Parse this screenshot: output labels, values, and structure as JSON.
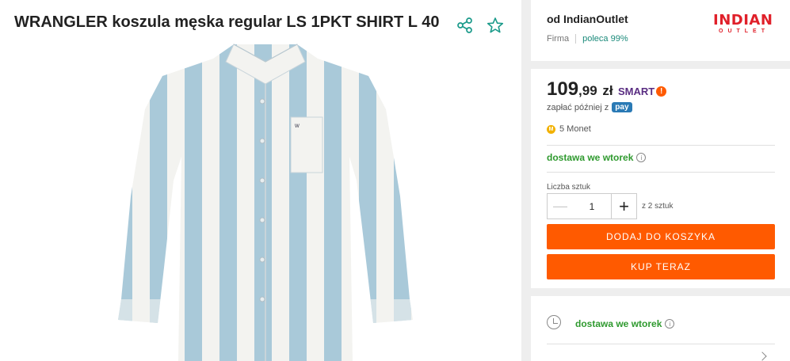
{
  "product": {
    "title": "WRANGLER koszula męska regular LS 1PKT SHIRT L 40",
    "icons": [
      "share-icon",
      "star-icon"
    ]
  },
  "seller": {
    "name": "od IndianOutlet",
    "type": "Firma",
    "recommend": "poleca 99%",
    "logo_top": "INDIAN",
    "logo_bottom": "OUTLET"
  },
  "price": {
    "main": "109",
    "cents": ",99",
    "currency": "zł",
    "smart": "SMART",
    "paylater": "zapłać później z",
    "paybadge": "pay",
    "coins": "5 Monet"
  },
  "delivery": {
    "label": "dostawa we wtorek"
  },
  "quantity": {
    "label": "Liczba sztuk",
    "value": "1",
    "of": "z 2 sztuk"
  },
  "buttons": {
    "add_to_cart": "DODAJ DO KOSZYKA",
    "buy_now": "KUP TERAZ"
  },
  "colors": {
    "accent": "#ff5a00",
    "delivery": "#2f9a2f",
    "stripe_blue": "#a9c9d9",
    "stripe_white": "#f3f3f0"
  }
}
